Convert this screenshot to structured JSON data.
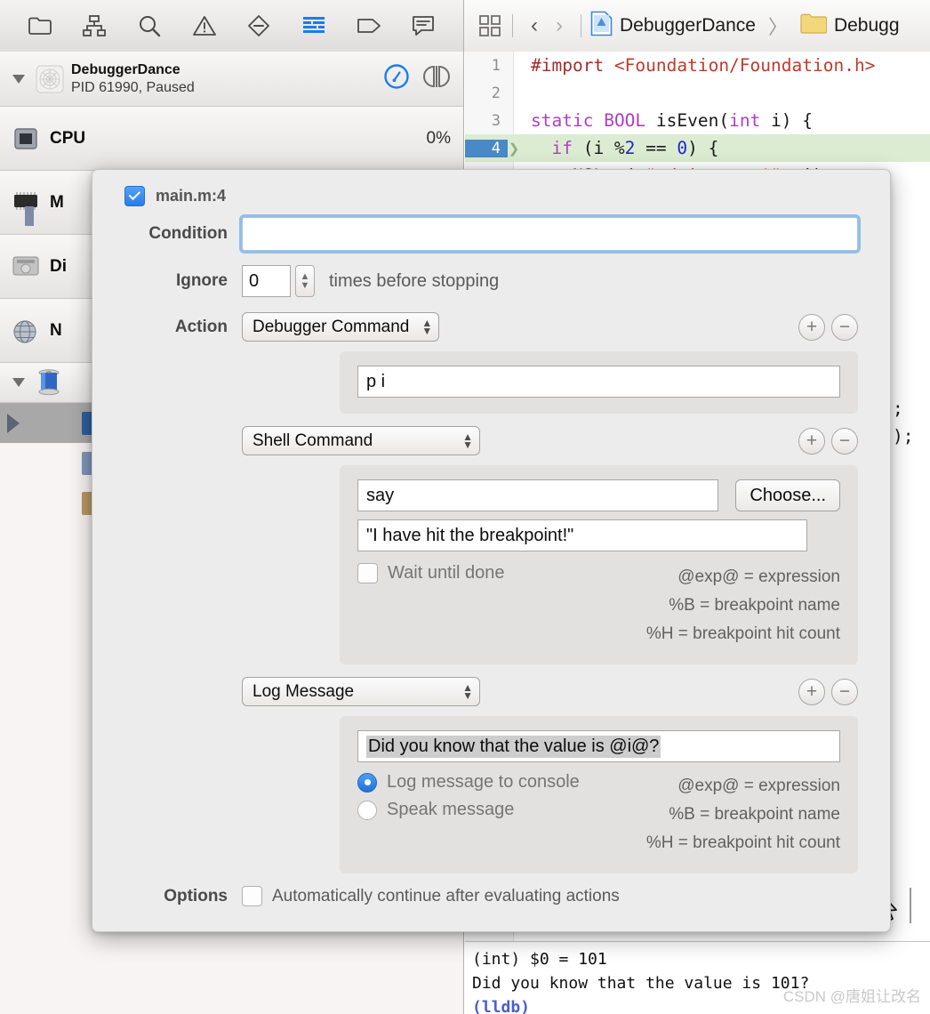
{
  "toolbar": {
    "navigator_icons": [
      {
        "name": "folder-icon",
        "label": "Project navigator"
      },
      {
        "name": "source-control-icon",
        "label": "Source control navigator"
      },
      {
        "name": "search-icon",
        "label": "Find navigator"
      },
      {
        "name": "warning-triangle-icon",
        "label": "Issue navigator"
      },
      {
        "name": "test-diamond-icon",
        "label": "Test navigator"
      },
      {
        "name": "debug-lines-icon",
        "label": "Debug navigator"
      },
      {
        "name": "breakpoint-tag-icon",
        "label": "Breakpoint navigator"
      },
      {
        "name": "report-bubble-icon",
        "label": "Report navigator"
      }
    ],
    "active_icon_index": 5,
    "accent_blue": "#1a7cf0",
    "grid_icon": "related-items-icon",
    "back_arrow": "‹",
    "forward_arrow": "›",
    "breadcrumb": [
      {
        "icon": "project-file-icon",
        "label": "DebuggerDance"
      },
      {
        "icon": "folder-yellow-icon",
        "label": "Debugg"
      }
    ],
    "breadcrumb_separator": "〉"
  },
  "navigator": {
    "process": {
      "name": "DebuggerDance",
      "status": "PID 61990, Paused",
      "disclosure": "open",
      "buttons": [
        {
          "name": "filter-gauge-icon"
        },
        {
          "name": "split-view-icon"
        }
      ]
    },
    "gauges": [
      {
        "icon": "cpu-chip-icon",
        "label": "CPU",
        "value": "0%"
      },
      {
        "icon": "memory-chip-icon",
        "label": "M",
        "value": ""
      },
      {
        "icon": "disk-icon",
        "label": "Di",
        "value": ""
      },
      {
        "icon": "network-globe-icon",
        "label": "N",
        "value": ""
      }
    ],
    "thread_section": {
      "icon": "thread-spool-icon",
      "disclosure": "open"
    },
    "frames": [
      {
        "selected": true,
        "badge_color": "#2f5f9e"
      },
      {
        "selected": false,
        "badge_color": "#7f98bb"
      },
      {
        "selected": false,
        "badge_color": "#b79a63"
      }
    ]
  },
  "editor": {
    "lines": [
      {
        "num": "1",
        "highlighted": false,
        "has_breakpoint": false,
        "tokens": [
          {
            "t": "#import ",
            "c": "k-pre"
          },
          {
            "t": "<Foundation/Foundation.h>",
            "c": "k-str"
          }
        ]
      },
      {
        "num": "2",
        "highlighted": false,
        "has_breakpoint": false,
        "tokens": []
      },
      {
        "num": "3",
        "highlighted": false,
        "has_breakpoint": false,
        "tokens": [
          {
            "t": "static ",
            "c": "k-kw"
          },
          {
            "t": "BOOL ",
            "c": "k-kw"
          },
          {
            "t": "isEven",
            "c": "k-fn"
          },
          {
            "t": "(",
            "c": "k-fn"
          },
          {
            "t": "int",
            "c": "k-kw"
          },
          {
            "t": " i) {",
            "c": "k-fn"
          }
        ]
      },
      {
        "num": "4",
        "highlighted": true,
        "has_breakpoint": true,
        "tokens": [
          {
            "t": "  ",
            "c": "k-fn"
          },
          {
            "t": "if",
            "c": "k-kw"
          },
          {
            "t": " (i %",
            "c": "k-fn"
          },
          {
            "t": "2",
            "c": "k-num"
          },
          {
            "t": " == ",
            "c": "k-fn"
          },
          {
            "t": "0",
            "c": "k-num"
          },
          {
            "t": ") {",
            "c": "k-fn"
          }
        ]
      },
      {
        "num": "5",
        "highlighted": false,
        "has_breakpoint": false,
        "tokens": [
          {
            "t": "    NSLog(@",
            "c": "k-fn"
          },
          {
            "t": "\"%d is even!\"",
            "c": "k-str"
          },
          {
            "t": ", i);",
            "c": "k-fn"
          }
        ]
      }
    ],
    "occluded_fragments": [
      ";",
      ");"
    ]
  },
  "console": {
    "lines": [
      {
        "text": "(int) $0 = 101",
        "style": "plain"
      },
      {
        "text": "Did you know that the value is 101?",
        "style": "plain"
      },
      {
        "text": "(lldb)",
        "style": "lldb"
      }
    ],
    "watermark": "CSDN @唐姐让改名"
  },
  "popover": {
    "enabled_checkbox": true,
    "title": "main.m:4",
    "condition": {
      "label": "Condition",
      "value": "",
      "placeholder": "",
      "focused": true
    },
    "ignore": {
      "label": "Ignore",
      "value": "0",
      "suffix": "times before stopping",
      "stepper_up": "▲",
      "stepper_down": "▼"
    },
    "action_label": "Action",
    "add_button": "+",
    "remove_button": "−",
    "actions": [
      {
        "type": "debugger-command",
        "select_value": "Debugger Command",
        "command": "p i"
      },
      {
        "type": "shell-command",
        "select_value": "Shell Command",
        "command": "say",
        "arguments": "\"I have hit the breakpoint!\"",
        "wait_label": "Wait until done",
        "wait_checked": false,
        "choose_label": "Choose...",
        "hints": [
          "@exp@ = expression",
          "%B = breakpoint name",
          "%H = breakpoint hit count"
        ]
      },
      {
        "type": "log-message",
        "select_value": "Log Message",
        "message": "Did you know that the value is @i@?",
        "message_selected": true,
        "options": [
          {
            "label": "Log message to console",
            "selected": true
          },
          {
            "label": "Speak message",
            "selected": false
          }
        ],
        "hints": [
          "@exp@ = expression",
          "%B = breakpoint name",
          "%H = breakpoint hit count"
        ]
      }
    ],
    "options": {
      "label": "Options",
      "auto_continue_label": "Automatically continue after evaluating actions",
      "auto_continue_checked": false
    }
  }
}
